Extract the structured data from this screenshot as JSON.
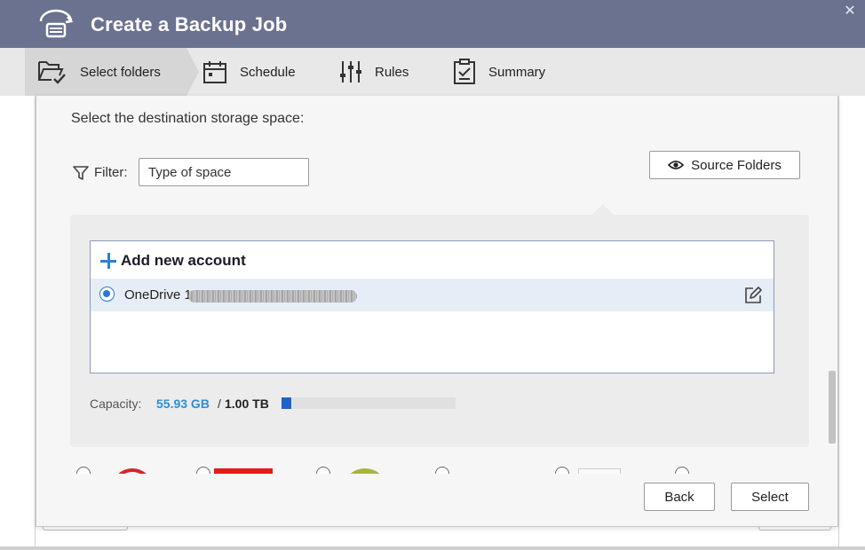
{
  "window": {
    "title": "Create a Backup Job",
    "close_glyph": "✕",
    "title_icon": "backup-drive-icon"
  },
  "steps": [
    {
      "label": "Select folders",
      "icon": "folder-check-icon",
      "active": true
    },
    {
      "label": "Schedule",
      "icon": "calendar-icon",
      "active": false
    },
    {
      "label": "Rules",
      "icon": "sliders-icon",
      "active": false
    },
    {
      "label": "Summary",
      "icon": "clipboard-check-icon",
      "active": false
    }
  ],
  "destination": {
    "heading": "Select the destination storage space:",
    "filter_label": "Filter:",
    "filter_value": "Type of space",
    "source_folders_label": "Source Folders"
  },
  "accounts": {
    "add_label": "Add new account",
    "items": [
      {
        "name": "OneDrive 1",
        "selected": true
      }
    ]
  },
  "capacity": {
    "label": "Capacity:",
    "used": "55.93 GB",
    "separator": "/",
    "total": "1.00 TB",
    "used_fraction": 0.0546
  },
  "footer": {
    "back_label": "Back",
    "select_label": "Select"
  },
  "colors": {
    "titlebar": "#6b7290",
    "accent_blue": "#2a8fd6",
    "capacity_fill": "#1e62c8",
    "selected_row": "#e6edf7"
  }
}
